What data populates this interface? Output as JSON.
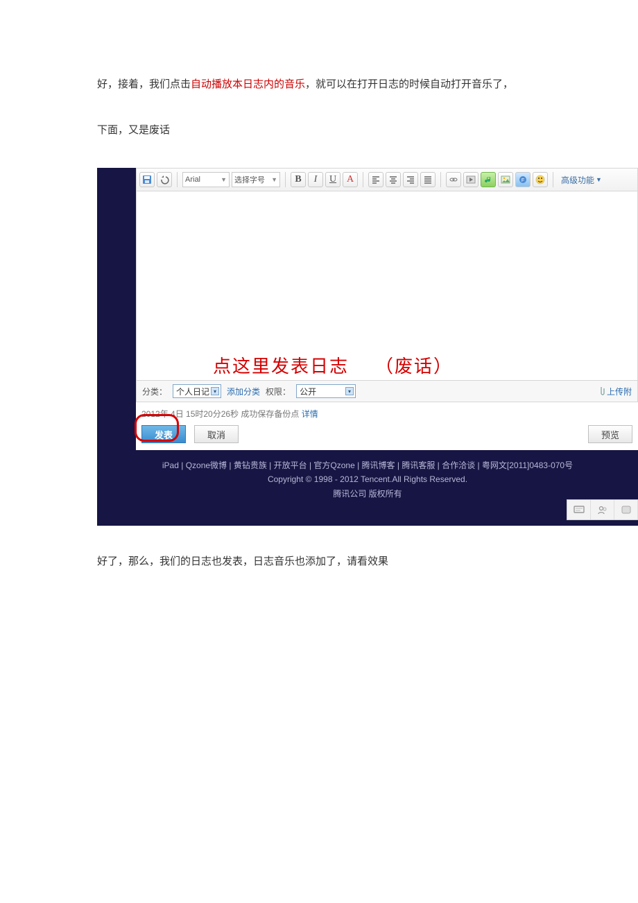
{
  "doc": {
    "para1_a": "好，接着，我们点击",
    "para1_red": "自动播放本日志内的音乐",
    "para1_b": "，就可以在打开日志的时候自动打开音乐了，",
    "para2": "下面，又是废话",
    "para3": "好了，那么，我们的日志也发表，日志音乐也添加了，请看效果"
  },
  "toolbar": {
    "font": "Arial",
    "size_placeholder": "选择字号",
    "advanced": "高级功能"
  },
  "annotation": {
    "label_a": "点这里发表日志",
    "label_b": "（废话）"
  },
  "status": {
    "category_label": "分类：",
    "category_value": "个人日记",
    "add_category": "添加分类",
    "perm_label": "权限：",
    "perm_value": "公开",
    "upload_label": "上传附"
  },
  "save": {
    "timestamp": "2012年 4日 15时20分26秒 成功保存备份点",
    "detail": "详情"
  },
  "buttons": {
    "publish": "发表",
    "cancel": "取消",
    "preview": "预览"
  },
  "footer": {
    "links": "iPad | Qzone微博 | 黄钻贵族 | 开放平台 | 官方Qzone | 腾讯博客 | 腾讯客服 | 合作洽谈 | 粤网文[2011]0483-070号",
    "copyright": "Copyright © 1998 - 2012 Tencent.All Rights Reserved.",
    "company": "腾讯公司 版权所有"
  }
}
